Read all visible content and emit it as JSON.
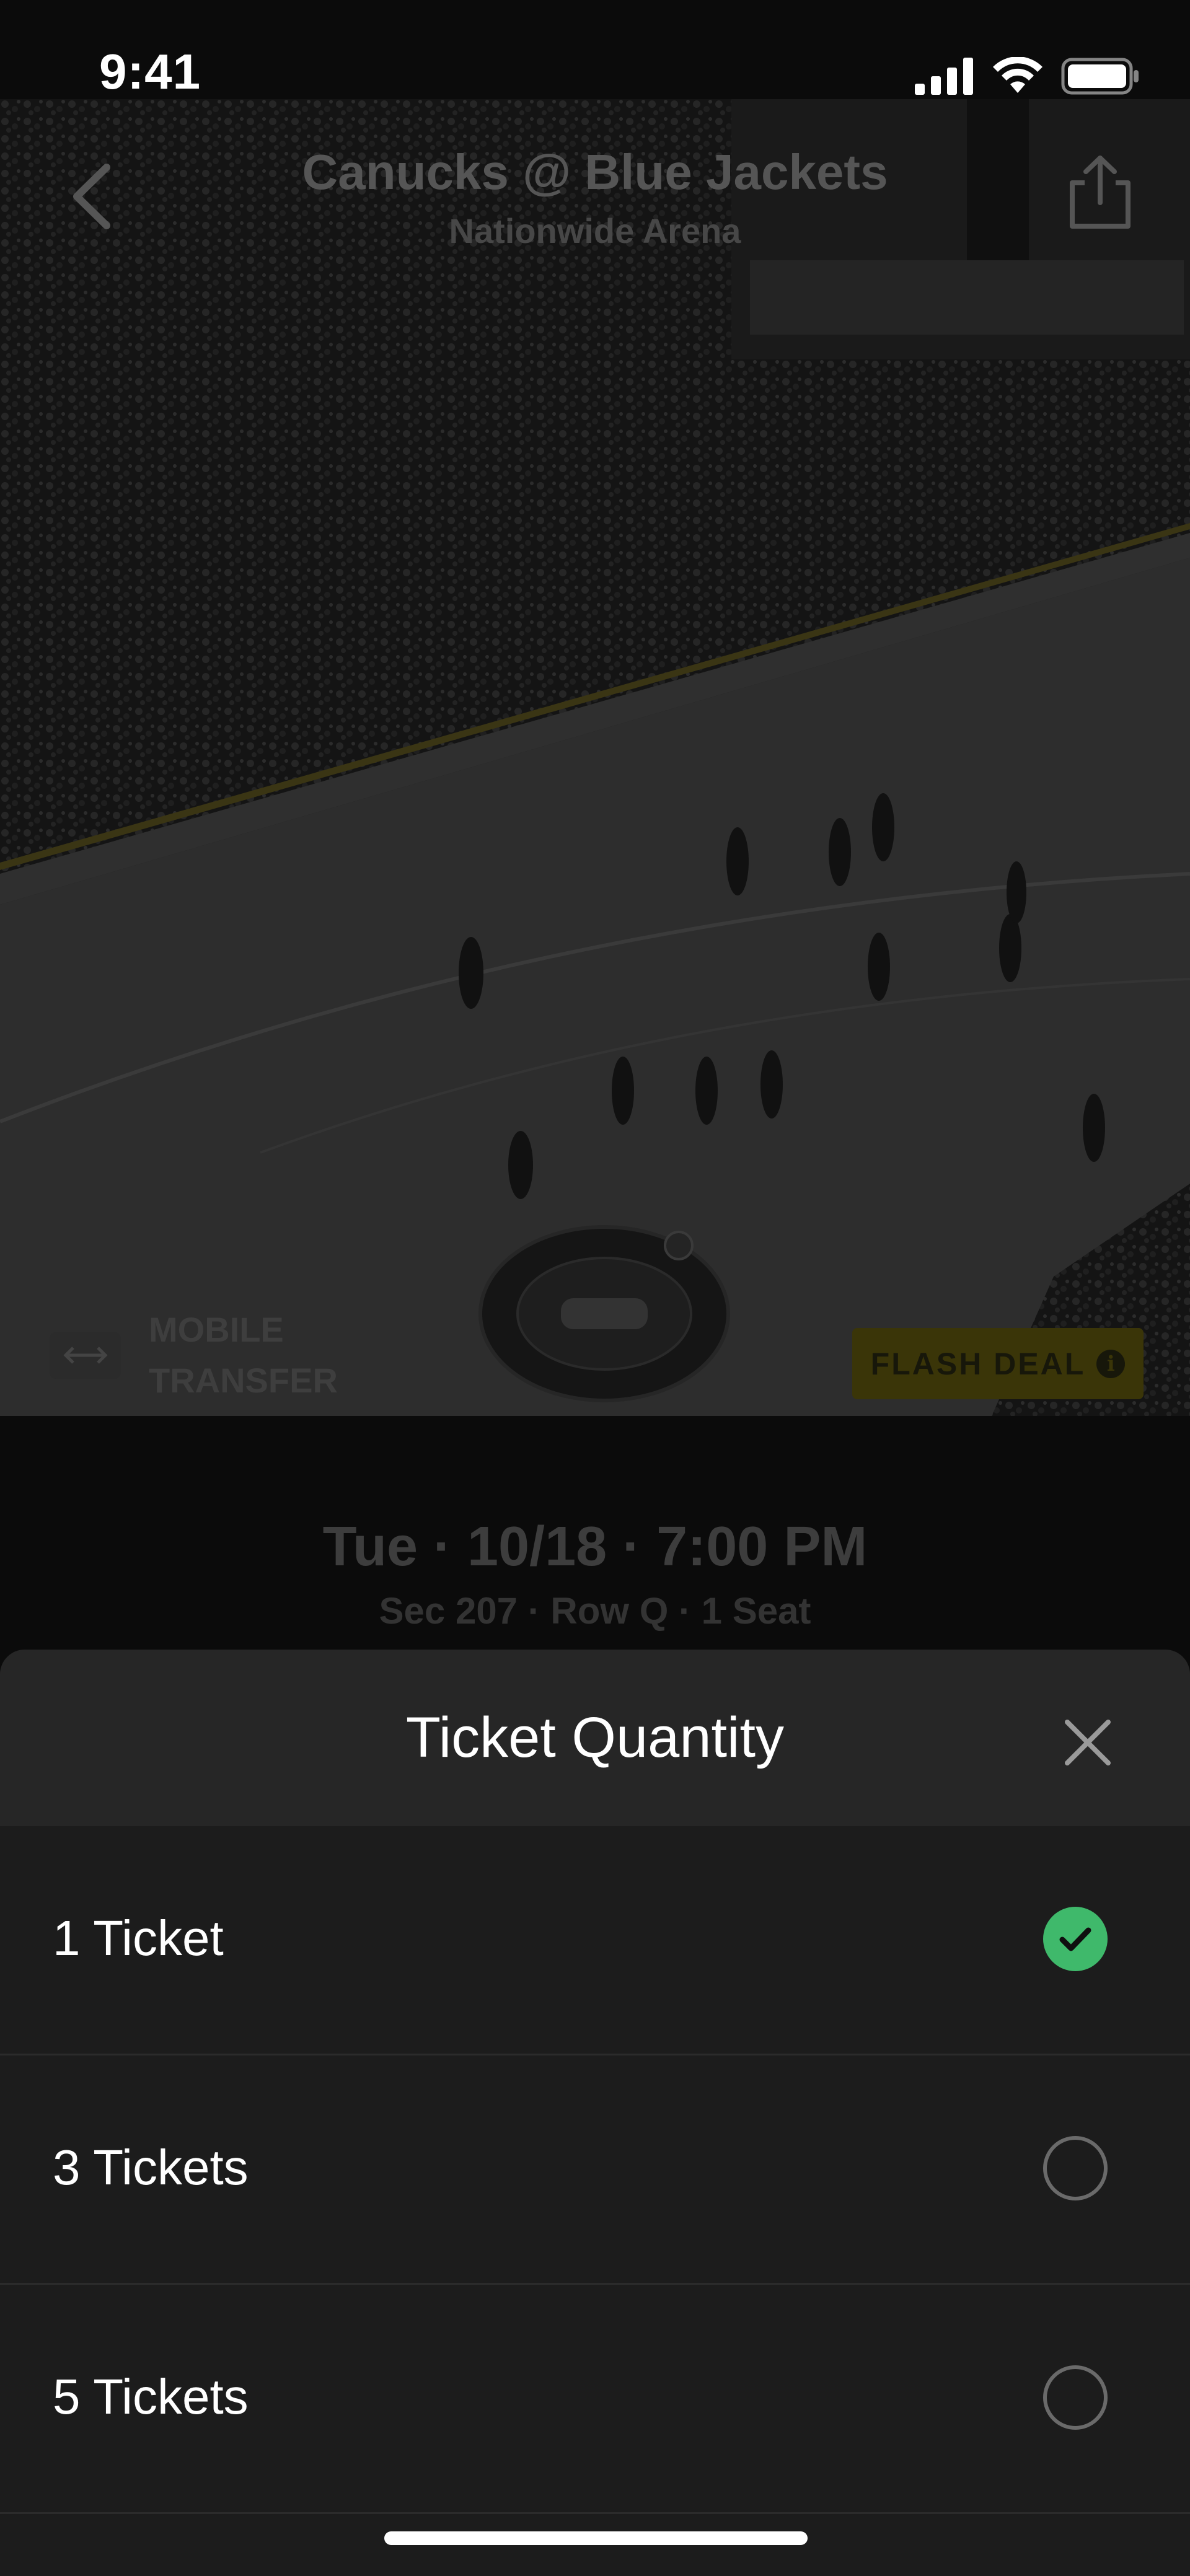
{
  "status_bar": {
    "time": "9:41"
  },
  "event": {
    "title": "Canucks @ Blue Jackets",
    "venue": "Nationwide Arena",
    "date_line": "Tue · 10/18 · 7:00 PM",
    "seat_line": "Sec 207 · Row Q · 1 Seat"
  },
  "badges": {
    "mobile_transfer": "MOBILE TRANSFER",
    "flash_deal": "FLASH DEAL"
  },
  "sheet": {
    "title": "Ticket Quantity",
    "options": [
      {
        "label": "1 Ticket",
        "selected": true
      },
      {
        "label": "3 Tickets",
        "selected": false
      },
      {
        "label": "5 Tickets",
        "selected": false
      }
    ]
  },
  "colors": {
    "accent_green": "#3fb96b",
    "sheet_bg": "#1c1c1c",
    "sheet_header_bg": "#262626",
    "flash_deal_bg": "#3a3508"
  },
  "icons": {
    "back": "chevron-left-icon",
    "share": "share-icon",
    "close": "close-icon",
    "check": "check-icon",
    "transfer": "transfer-arrows-icon",
    "info": "info-icon"
  }
}
